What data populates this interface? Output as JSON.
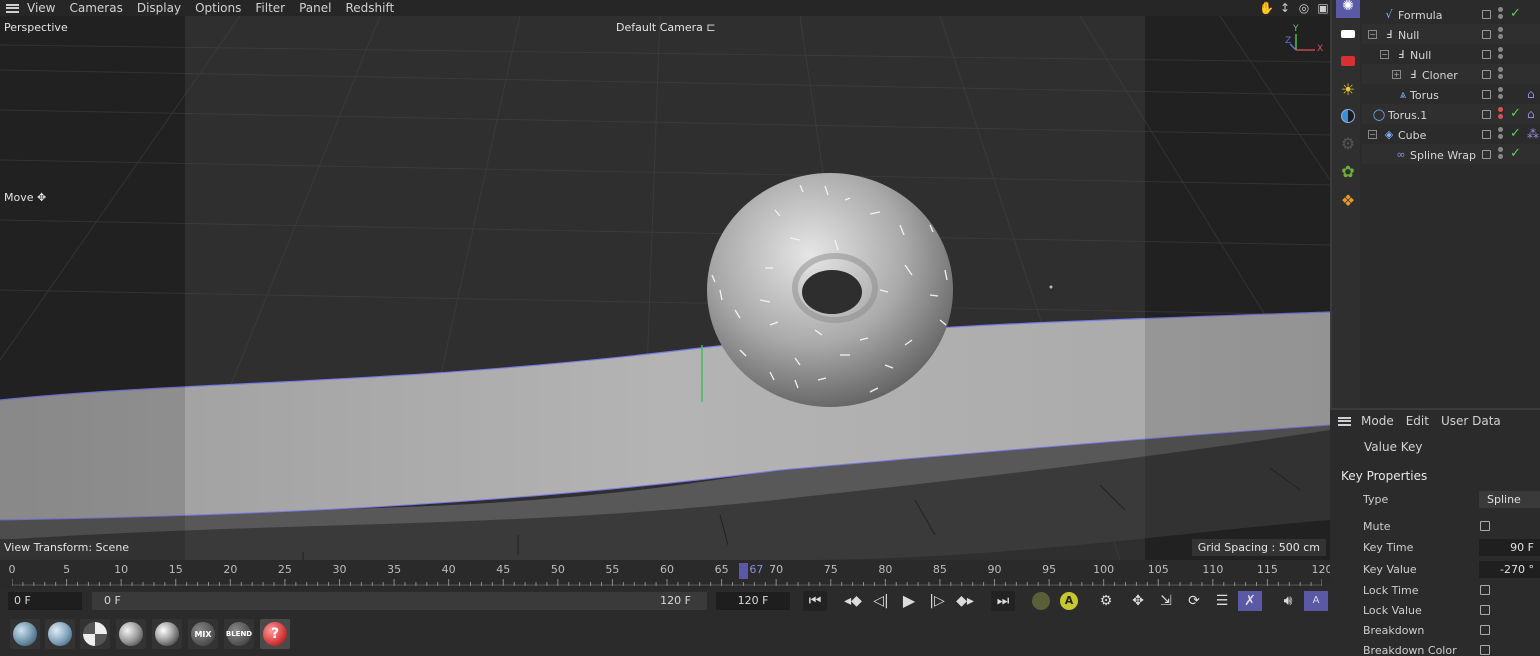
{
  "viewport": {
    "menu": [
      "View",
      "Cameras",
      "Display",
      "Options",
      "Filter",
      "Panel",
      "Redshift"
    ],
    "view_name": "Perspective",
    "camera": "Default Camera",
    "tool": "Move",
    "view_transform": "View Transform: Scene",
    "grid_spacing": "Grid Spacing : 500 cm",
    "axis": {
      "y": "Y",
      "z": "Z",
      "x": "X"
    },
    "header_icons": [
      "hand-icon",
      "move-arrows-icon",
      "orbit-icon",
      "maximize-icon"
    ]
  },
  "timeline": {
    "ticks": [
      "0",
      "5",
      "10",
      "15",
      "20",
      "25",
      "30",
      "35",
      "40",
      "45",
      "50",
      "55",
      "60",
      "65",
      "70",
      "75",
      "80",
      "85",
      "90",
      "95",
      "100",
      "105",
      "110",
      "115",
      "120"
    ],
    "current_frame": "67",
    "max_frame": 120
  },
  "transport": {
    "current_time": "0 F",
    "range_start": "0 F",
    "range_end": "120 F",
    "end_time": "120 F",
    "auto_label": "A",
    "buttons": [
      "go-to-start",
      "prev-key",
      "prev-frame",
      "play",
      "next-frame",
      "next-key",
      "go-to-end"
    ]
  },
  "materials": [
    {
      "name": "material-1",
      "color": "#6b8fa8"
    },
    {
      "name": "material-2",
      "color": "#7ea0b8"
    },
    {
      "name": "material-checker",
      "color": "#bbbbbb"
    },
    {
      "name": "material-4",
      "color": "#9a9a9a"
    },
    {
      "name": "material-5",
      "color": "#aaaaaa"
    },
    {
      "name": "material-mix",
      "label": "MIX"
    },
    {
      "name": "material-blend",
      "label": "BLEND"
    },
    {
      "name": "material-missing",
      "color": "#d94040"
    }
  ],
  "objects": [
    {
      "name": "Formula",
      "icon": "formula-icon",
      "icon_color": "#7fb0ff",
      "indent": 1,
      "check": true
    },
    {
      "name": "Null",
      "icon": "null-icon",
      "icon_color": "#dddddd",
      "indent": 0,
      "expander": "-"
    },
    {
      "name": "Null",
      "icon": "null-icon",
      "icon_color": "#dddddd",
      "indent": 1,
      "expander": "-"
    },
    {
      "name": "Cloner",
      "icon": "cloner-icon",
      "icon_color": "#dddddd",
      "indent": 2,
      "expander": "+"
    },
    {
      "name": "Torus",
      "icon": "surface-icon",
      "icon_color": "#7fb0ff",
      "indent": 2
    },
    {
      "name": "Torus.1",
      "icon": "torus-icon",
      "icon_color": "#7fb0ff",
      "indent": 0,
      "check": true,
      "red_dot": true,
      "tag": true
    },
    {
      "name": "Cube",
      "icon": "cube-icon",
      "icon_color": "#7fb0ff",
      "indent": 0,
      "expander": "-",
      "check": true,
      "tag": true
    },
    {
      "name": "Spline Wrap",
      "icon": "spline-wrap-icon",
      "icon_color": "#8e8ee0",
      "indent": 1,
      "check": true
    }
  ],
  "attributes": {
    "menu": [
      "Mode",
      "Edit",
      "User Data"
    ],
    "mode_title": "Value Key",
    "section": "Key Properties",
    "props": [
      {
        "label": "Type",
        "kind": "select",
        "value": "Spline"
      },
      {
        "label": "Mute",
        "kind": "checkbox"
      },
      {
        "label": "Key Time",
        "kind": "field",
        "value": "90 F"
      },
      {
        "label": "Key Value",
        "kind": "field",
        "value": "-270 °"
      },
      {
        "label": "Lock Time",
        "kind": "checkbox"
      },
      {
        "label": "Lock Value",
        "kind": "checkbox"
      },
      {
        "label": "Breakdown",
        "kind": "checkbox"
      },
      {
        "label": "Breakdown Color",
        "kind": "checkbox"
      }
    ]
  },
  "colors": {
    "accent": "#5a59a6",
    "check_green": "#58d158",
    "spline_blue": "#7b7be8",
    "auto_yellow": "#c6c630"
  }
}
